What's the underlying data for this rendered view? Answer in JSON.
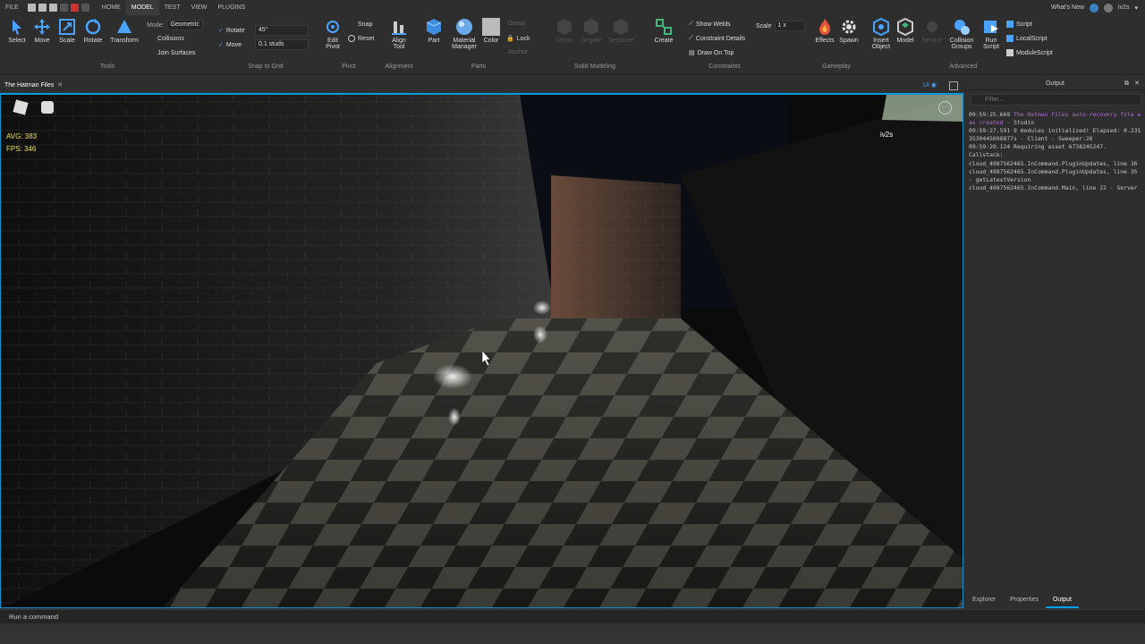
{
  "menubar": {
    "file": "FILE",
    "tabs": [
      "HOME",
      "MODEL",
      "TEST",
      "VIEW",
      "PLUGINS"
    ],
    "active_tab": "MODEL",
    "whats_new": "What's New",
    "user": "iv2s"
  },
  "ribbon": {
    "tools": {
      "group": "Tools",
      "select": "Select",
      "move": "Move",
      "scale": "Scale",
      "rotate": "Rotate",
      "transform": "Transform"
    },
    "mode": {
      "label": "Mode:",
      "value": "Geometric",
      "collisions": "Collisions",
      "join_surfaces": "Join Surfaces"
    },
    "snap": {
      "group": "Snap to Grid",
      "rotate_label": "Rotate",
      "rotate_value": "45°",
      "move_label": "Move",
      "move_value": "0.1 studs"
    },
    "pivot": {
      "group": "Pivot",
      "edit_pivot": "Edit Pivot",
      "snap": "Snap",
      "reset": "Reset"
    },
    "alignment": {
      "group": "Alignment",
      "align_tool": "Align Tool"
    },
    "parts": {
      "group": "Parts",
      "part": "Part",
      "material_manager": "Material Manager",
      "color": "Color",
      "group_btn": "Group",
      "lock": "Lock",
      "anchor": "Anchor"
    },
    "solid": {
      "group": "Solid Modeling",
      "union": "Union",
      "negate": "Negate",
      "separate": "Separate"
    },
    "constraints": {
      "group": "Constraints",
      "create": "Create",
      "show_welds": "Show Welds",
      "constraint_details": "Constraint Details",
      "draw_on_top": "Draw On Top",
      "scale_label": "Scale",
      "scale_value": "1 x"
    },
    "gameplay": {
      "group": "Gameplay",
      "effects": "Effects",
      "spawn": "Spawn"
    },
    "insert": {
      "insert_object": "Insert Object",
      "model": "Model",
      "service": "Service"
    },
    "advanced": {
      "group": "Advanced",
      "collision_groups": "Collision Groups",
      "run_script": "Run Script",
      "script": "Script",
      "local_script": "LocalScript",
      "module_script": "ModuleScript"
    }
  },
  "document": {
    "tab_title": "The Hatman Files",
    "ui_toggle": "UI"
  },
  "viewport": {
    "avg": "AVG: 383",
    "fps": "FPS: 346",
    "player_name": "iv2s"
  },
  "output": {
    "title": "Output",
    "filter_placeholder": "Filter...",
    "lines": [
      {
        "time": "09:59:25.669",
        "text": "The Hatman Files auto-recovery file was created",
        "suffix": " - Studio",
        "magenta": true
      },
      {
        "time": "09:59:27.591",
        "text": "9 modules initialized! Elapsed: 0.2313530445098877s",
        "suffix": " - Client - Sweeper:26",
        "magenta": false
      },
      {
        "time": "09:59:29.124",
        "text": "Requiring asset 6738245247.",
        "suffix": "",
        "magenta": false
      },
      {
        "time": "",
        "text": "Callstack:",
        "suffix": "",
        "magenta": false
      },
      {
        "time": "",
        "text": "cloud_4987562465.InCommand.PluginUpdates, line 36",
        "suffix": "",
        "magenta": false
      },
      {
        "time": "",
        "text": "cloud_4987562465.InCommand.PluginUpdates, line 35 - getLatestVersion",
        "suffix": "",
        "magenta": false
      },
      {
        "time": "",
        "text": "cloud_4987562465.InCommand.Main, line 22",
        "suffix": " - Server",
        "magenta": false
      }
    ]
  },
  "bottom_tabs": [
    "Explorer",
    "Properties",
    "Output"
  ],
  "command_bar": {
    "placeholder": "Run a command"
  },
  "colors": {
    "accent": "#00a2ff",
    "magenta": "#b36bd6",
    "fps_text": "#e8e15a"
  }
}
